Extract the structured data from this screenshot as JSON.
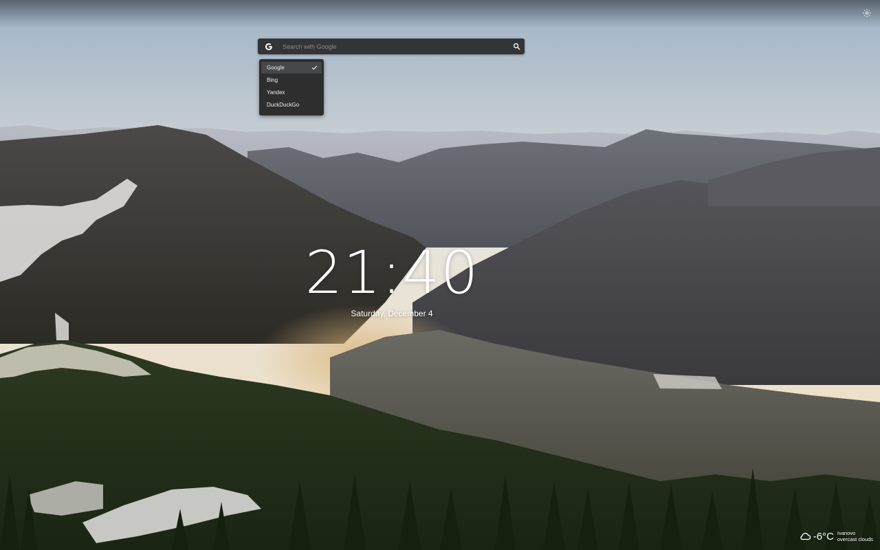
{
  "search": {
    "placeholder": "Search with Google",
    "engine_icon": "google-icon",
    "submit_icon": "search-icon"
  },
  "engine_menu": {
    "items": [
      {
        "label": "Google",
        "selected": true
      },
      {
        "label": "Bing",
        "selected": false
      },
      {
        "label": "Yandex",
        "selected": false
      },
      {
        "label": "DuckDuckGo",
        "selected": false
      }
    ]
  },
  "clock": {
    "time": "21:40",
    "date": "Saturday, December 4"
  },
  "weather": {
    "icon": "cloud-icon",
    "temperature": "-6°C",
    "city": "Ivanovo",
    "condition": "overcast clouds"
  },
  "settings": {
    "icon": "gear-icon"
  }
}
